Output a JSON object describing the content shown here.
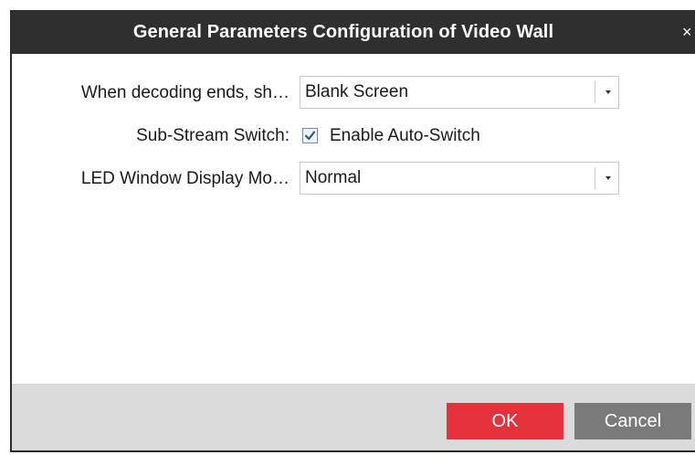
{
  "dialog": {
    "title": "General Parameters Configuration of Video Wall",
    "close_glyph": "×"
  },
  "form": {
    "decoding_end": {
      "label": "When decoding ends, sh…",
      "value": "Blank Screen"
    },
    "sub_stream": {
      "label": "Sub-Stream Switch:",
      "checkbox_label": "Enable Auto-Switch",
      "checked": true
    },
    "led_display_mode": {
      "label": "LED Window Display Mo…",
      "value": "Normal"
    }
  },
  "footer": {
    "ok_label": "OK",
    "cancel_label": "Cancel"
  },
  "colors": {
    "titlebar": "#2f2f2f",
    "ok_button": "#e3323c",
    "cancel_button": "#7a7a7a",
    "footer": "#dbdbdb"
  },
  "icons": [
    "close-icon",
    "chevron-down-icon",
    "checkmark-icon"
  ]
}
